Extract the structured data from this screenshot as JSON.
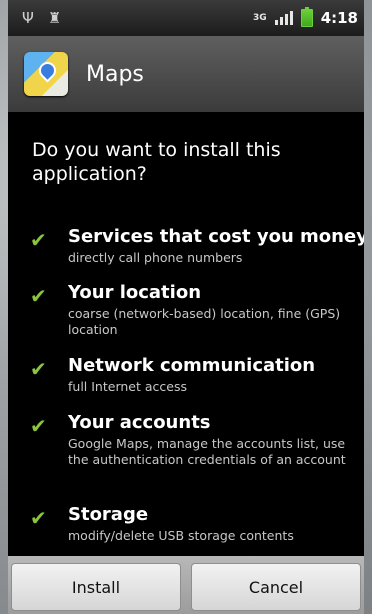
{
  "status_bar": {
    "network": "3G",
    "clock": "4:18"
  },
  "header": {
    "title": "Maps"
  },
  "main": {
    "question": "Do you want to install this application?",
    "permissions": [
      {
        "name": "Services that cost you money",
        "description": "directly call phone numbers"
      },
      {
        "name": "Your location",
        "description": "coarse (network-based) location, fine (GPS) location"
      },
      {
        "name": "Network communication",
        "description": "full Internet access"
      },
      {
        "name": "Your accounts",
        "description": "Google Maps, manage the accounts list, use the authentication credentials of an account"
      },
      {
        "name": "Storage",
        "description": "modify/delete USB storage contents"
      }
    ]
  },
  "buttons": {
    "install": "Install",
    "cancel": "Cancel"
  },
  "icons": {
    "usb": "usb-icon",
    "android": "android-icon",
    "check": "check-icon",
    "app": "maps-app-icon"
  },
  "colors": {
    "check_green": "#8bc53f",
    "battery_green": "#6ccf3a"
  }
}
